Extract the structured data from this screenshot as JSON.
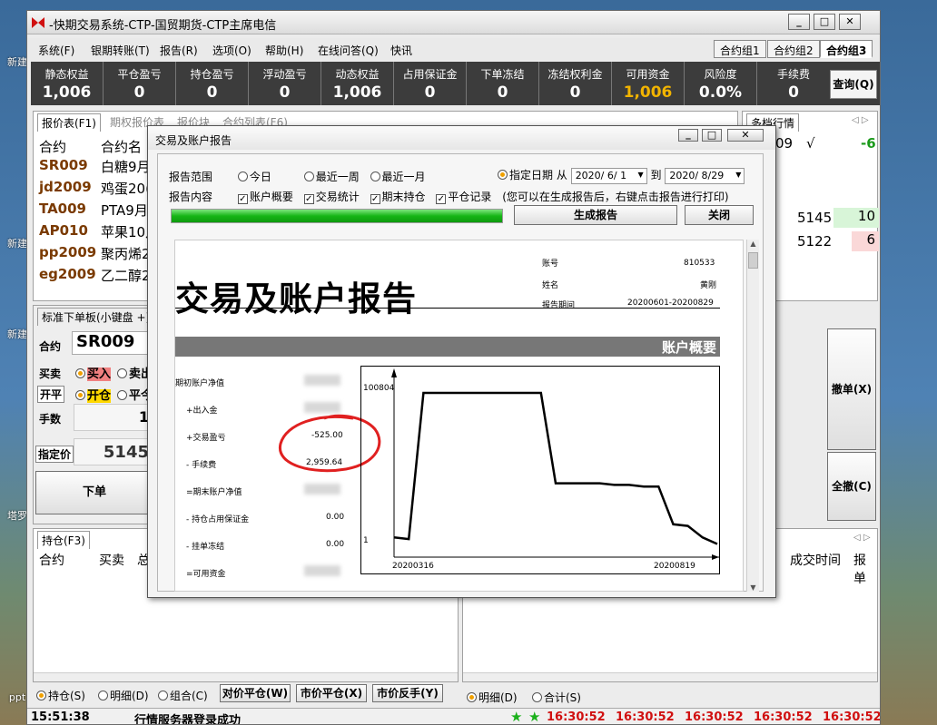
{
  "window_title": "-快期交易系统-CTP-国贸期货-CTP主席电信",
  "menu": [
    "系统(F)",
    "银期转账(T)",
    "报告(R)",
    "选项(O)",
    "帮助(H)",
    "在线问答(Q)",
    "快讯"
  ],
  "groups": [
    "合约组1",
    "合约组2",
    "合约组3"
  ],
  "stats": [
    {
      "label": "静态权益",
      "value": "1,006"
    },
    {
      "label": "平仓盈亏",
      "value": "0"
    },
    {
      "label": "持仓盈亏",
      "value": "0"
    },
    {
      "label": "浮动盈亏",
      "value": "0"
    },
    {
      "label": "动态权益",
      "value": "1,006"
    },
    {
      "label": "占用保证金",
      "value": "0"
    },
    {
      "label": "下单冻结",
      "value": "0"
    },
    {
      "label": "冻结权利金",
      "value": "0"
    },
    {
      "label": "可用资金",
      "value": "1,006"
    },
    {
      "label": "风险度",
      "value": "0.0%"
    },
    {
      "label": "手续费",
      "value": "0"
    }
  ],
  "query_button": "查询(Q)",
  "quote_tabs": [
    "报价表(F1)",
    "期权报价表",
    "报价块",
    "合约列表(F6)"
  ],
  "quote_headers": [
    "合约",
    "合约名"
  ],
  "quotes": [
    {
      "code": "SR009",
      "name": "白糖9月"
    },
    {
      "code": "jd2009",
      "name": "鸡蛋20("
    },
    {
      "code": "TA009",
      "name": "PTA9月"
    },
    {
      "code": "AP010",
      "name": "苹果10月"
    },
    {
      "code": "pp2009",
      "name": "聚丙烯2"
    },
    {
      "code": "eg2009",
      "name": "乙二醇2"
    }
  ],
  "depth_tab": "多档行情",
  "depth_row0": {
    "a": "09",
    "b": "√",
    "c": "-6"
  },
  "depth_rows": [
    {
      "price": "5145",
      "vol": "10"
    },
    {
      "price": "5122",
      "vol": "6"
    }
  ],
  "order_panel": {
    "title": "标准下单板(小键盘 +)",
    "contract_label": "合约",
    "contract": "SR009",
    "side_label": "买卖",
    "buy": "买入",
    "sell": "卖出",
    "open_label": "开平",
    "open": "开仓",
    "close": "平今",
    "qty_label": "手数",
    "qty": "1",
    "price_label": "指定价",
    "price": "5145",
    "submit": "下单"
  },
  "cancel_buttons": [
    "撤单(X)",
    "全撤(C)"
  ],
  "position_tab": "持仓(F3)",
  "position_headers": [
    "合约",
    "买卖",
    "总"
  ],
  "trade_headers": [
    "成交时间",
    "报单"
  ],
  "bottom_left_radios": [
    "持仓(S)",
    "明细(D)",
    "组合(C)"
  ],
  "bottom_left_buttons": [
    "对价平仓(W)",
    "市价平仓(X)",
    "市价反手(Y)"
  ],
  "bottom_right_radios": [
    "明细(D)",
    "合计(S)"
  ],
  "status": {
    "time": "15:51:38",
    "message": "行情服务器登录成功",
    "clocks": [
      "16:30:52",
      "16:30:52",
      "16:30:52",
      "16:30:52",
      "16:30:52"
    ]
  },
  "dialog": {
    "title": "交易及账户报告",
    "scope_label": "报告范围",
    "scope_options": [
      "今日",
      "最近一周",
      "最近一月",
      "指定日期"
    ],
    "from_label": "从",
    "from_date": "2020/ 6/ 1",
    "to_label": "到",
    "to_date": "2020/ 8/29",
    "content_label": "报告内容",
    "content_options": [
      "账户概要",
      "交易统计",
      "期末持仓",
      "平仓记录"
    ],
    "hint": "(您可以在生成报告后，右键点击报告进行打印)",
    "generate_button": "生成报告",
    "close_button": "关闭",
    "progress": 1.0
  },
  "report": {
    "title": "交易及账户报告",
    "account_label": "账号",
    "account": "810533",
    "name_label": "姓名",
    "name": "黄刚",
    "period_label": "报告期间",
    "period": "20200601-20200829",
    "section": "账户概要",
    "rows": [
      {
        "label": "期初账户净值",
        "value": ""
      },
      {
        "label": "+出入金",
        "value": ""
      },
      {
        "label": "+交易盈亏",
        "value": "-525.00"
      },
      {
        "label": "- 手续费",
        "value": "2,959.64"
      },
      {
        "label": "=期末账户净值",
        "value": ""
      },
      {
        "label": "- 持仓占用保证金",
        "value": "0.00"
      },
      {
        "label": "- 挂单冻结",
        "value": "0.00"
      },
      {
        "label": "=可用资金",
        "value": ""
      }
    ],
    "chart": {
      "ymax_label": "100804",
      "ymin_label": "1",
      "x_start": "20200316",
      "x_end": "20200819"
    }
  },
  "chart_data": {
    "type": "line",
    "title": "",
    "xlabel": "",
    "ylabel": "",
    "x": [
      0,
      1,
      2,
      3,
      4,
      5,
      6,
      7,
      8,
      9,
      10,
      11,
      12,
      13,
      14,
      15,
      16,
      17,
      18,
      19,
      20,
      21,
      22
    ],
    "values": [
      12,
      11,
      100,
      100,
      100,
      100,
      100,
      100,
      100,
      100,
      100,
      45,
      45,
      45,
      45,
      44,
      44,
      43,
      43,
      20,
      19,
      12,
      8
    ],
    "ylim": [
      0,
      105
    ],
    "grid": false
  },
  "desktop_icons": [
    "新建",
    "新建",
    "新建",
    "塔罗",
    "ppt"
  ]
}
